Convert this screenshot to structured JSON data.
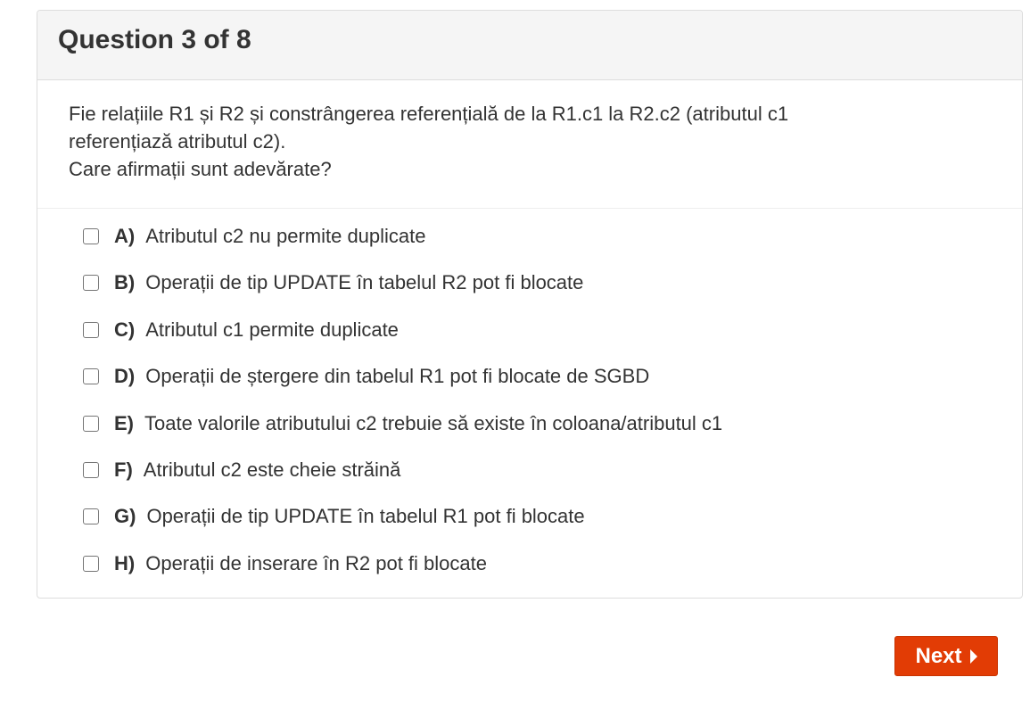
{
  "header": {
    "title": "Question 3 of 8"
  },
  "question": {
    "lines": [
      "Fie relațiile R1 și R2 și constrângerea referențială de la R1.c1 la R2.c2 (atributul c1",
      "referențiază atributul c2).",
      "Care afirmații sunt adevărate?"
    ]
  },
  "answers": [
    {
      "letter": "A)",
      "text": "Atributul c2 nu permite duplicate",
      "checked": false
    },
    {
      "letter": "B)",
      "text": "Operații de tip UPDATE în tabelul R2 pot fi blocate",
      "checked": false
    },
    {
      "letter": "C)",
      "text": "Atributul c1 permite duplicate",
      "checked": false
    },
    {
      "letter": "D)",
      "text": "Operații de ștergere din tabelul R1 pot fi blocate de SGBD",
      "checked": false
    },
    {
      "letter": "E)",
      "text": "Toate valorile atributului c2 trebuie să existe în coloana/atributul c1",
      "checked": false
    },
    {
      "letter": "F)",
      "text": "Atributul c2 este cheie străină",
      "checked": false
    },
    {
      "letter": "G)",
      "text": "Operații de tip UPDATE în tabelul R1 pot fi blocate",
      "checked": false
    },
    {
      "letter": "H)",
      "text": "Operații de inserare în R2 pot fi blocate",
      "checked": false
    }
  ],
  "footer": {
    "next_label": "Next",
    "next_icon": "caret-right-icon"
  },
  "colors": {
    "accent": "#e23c05",
    "heading_bg": "#f5f5f5",
    "border": "#dddddd"
  }
}
